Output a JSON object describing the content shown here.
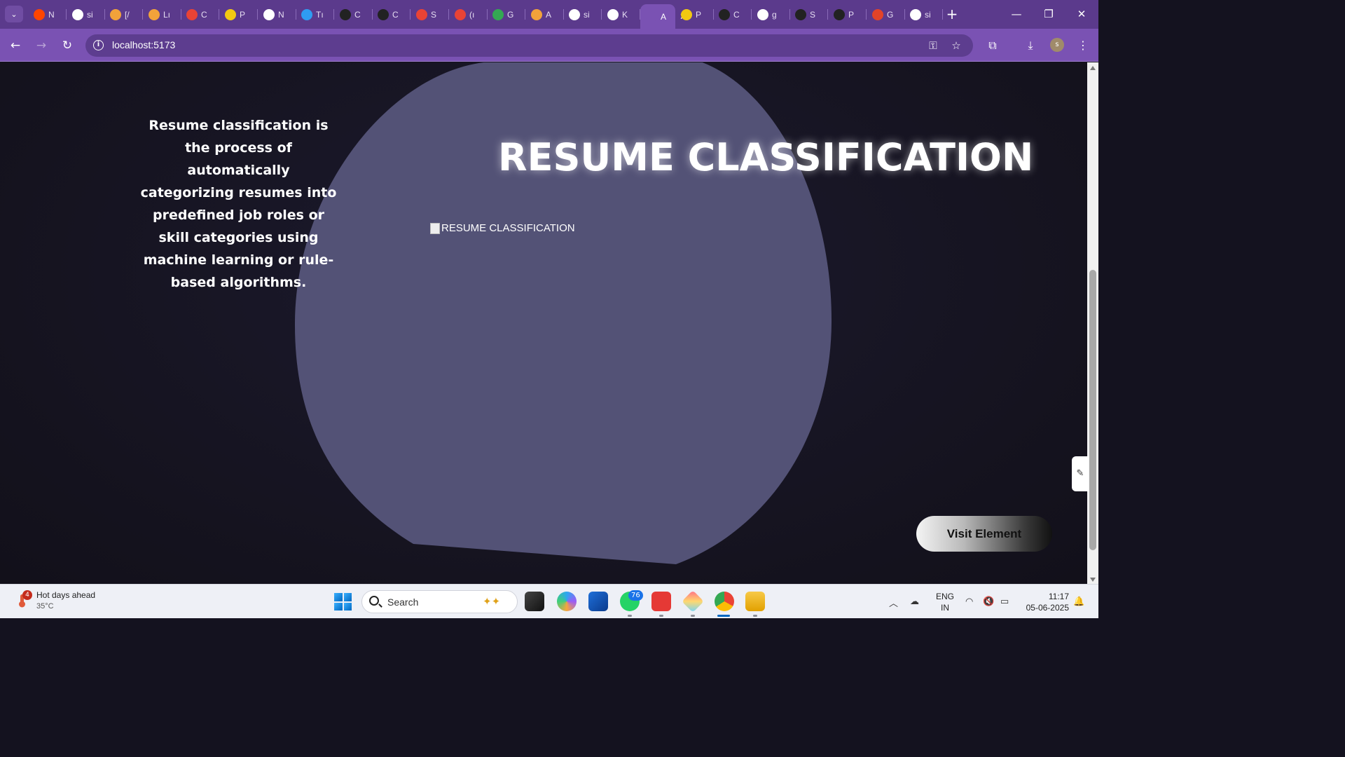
{
  "browser": {
    "tabs": [
      {
        "label": "N",
        "icon": "reddit-icon",
        "color": "#ff4500"
      },
      {
        "label": "si",
        "icon": "google-icon",
        "color": "#ffffff"
      },
      {
        "label": "[/",
        "icon": "codecrafters-icon",
        "color": "#f2a23a"
      },
      {
        "label": "Lı",
        "icon": "codecrafters-icon",
        "color": "#f2a23a"
      },
      {
        "label": "C",
        "icon": "gmail-icon",
        "color": "#ea4335"
      },
      {
        "label": "P",
        "icon": "powerbi-icon",
        "color": "#f2c811"
      },
      {
        "label": "N",
        "icon": "chrome-icon",
        "color": "#ffffff"
      },
      {
        "label": "Tı",
        "icon": "vscode-icon",
        "color": "#2f9cf2"
      },
      {
        "label": "C",
        "icon": "github-icon",
        "color": "#222222"
      },
      {
        "label": "C",
        "icon": "openai-icon",
        "color": "#222222"
      },
      {
        "label": "S",
        "icon": "slides-icon",
        "color": "#ea4335"
      },
      {
        "label": "(ı",
        "icon": "gmail-icon",
        "color": "#ea4335"
      },
      {
        "label": "G",
        "icon": "drive-icon",
        "color": "#34a853"
      },
      {
        "label": "A",
        "icon": "codecrafters-icon",
        "color": "#f2a23a"
      },
      {
        "label": "si",
        "icon": "google-icon",
        "color": "#ffffff"
      },
      {
        "label": "K",
        "icon": "google-icon",
        "color": "#ffffff"
      },
      {
        "label": "A",
        "icon": "react-icon",
        "color": "#7a52b3",
        "active": true
      },
      {
        "label": "P",
        "icon": "powerbi-icon",
        "color": "#f2c811"
      },
      {
        "label": "C",
        "icon": "openai-icon",
        "color": "#222222"
      },
      {
        "label": "g",
        "icon": "google-icon",
        "color": "#ffffff"
      },
      {
        "label": "S",
        "icon": "github-icon",
        "color": "#222222"
      },
      {
        "label": "P",
        "icon": "openai-icon",
        "color": "#222222"
      },
      {
        "label": "G",
        "icon": "gitlab-icon",
        "color": "#e24329"
      },
      {
        "label": "si",
        "icon": "google-icon",
        "color": "#ffffff"
      }
    ],
    "url": "localhost:5173",
    "profile_initial": "s"
  },
  "page": {
    "description": "Resume classification is the process of automatically categorizing resumes into predefined job roles or skill categories using machine learning or rule-based algorithms.",
    "title": "RESUME CLASSIFICATION",
    "image_alt": "RESUME CLASSIFICATION",
    "visit_button": "Visit Element",
    "colors": {
      "background": "#15131f",
      "blob": "#535276",
      "title": "#ffffff"
    }
  },
  "taskbar": {
    "weather_title": "Hot days ahead",
    "weather_temp": "35°C",
    "weather_badge": "4",
    "search_placeholder": "Search",
    "whatsapp_badge": "76",
    "lang_line1": "ENG",
    "lang_line2": "IN",
    "time": "11:17",
    "date": "05-06-2025"
  }
}
